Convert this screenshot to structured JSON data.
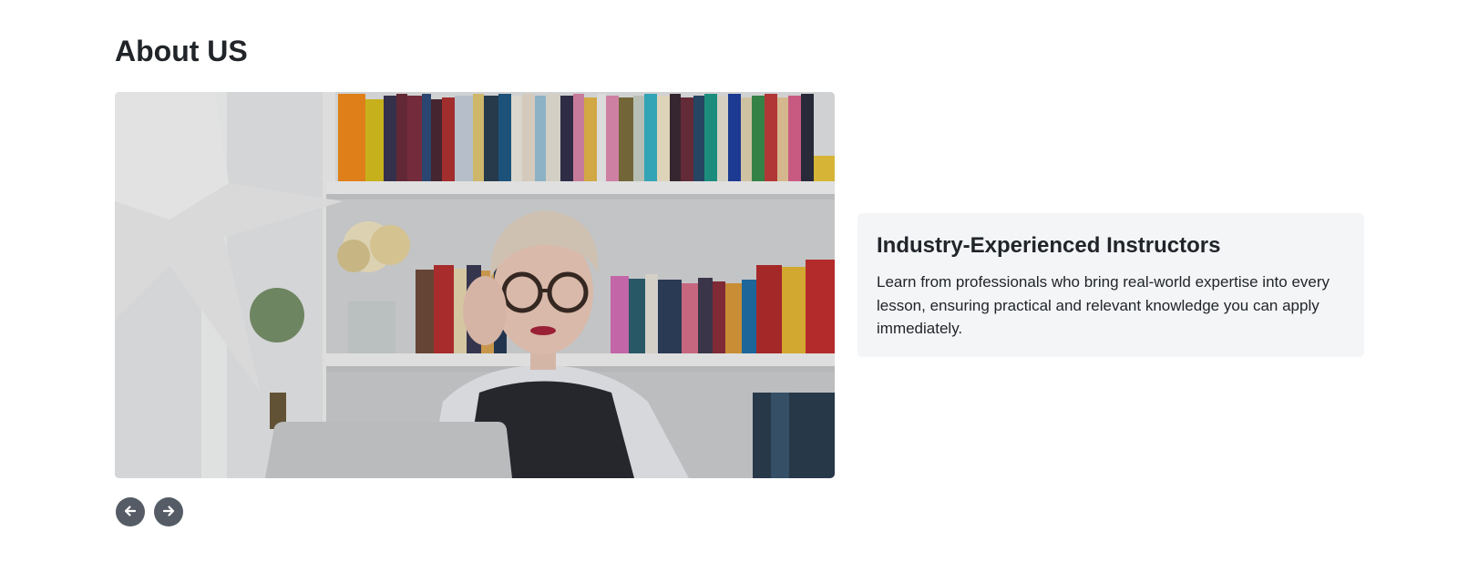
{
  "section": {
    "title": "About US"
  },
  "slide": {
    "image_alt": "Woman with glasses sitting in front of a bookshelf",
    "heading": "Industry-Experienced Instructors",
    "body": "Learn from professionals who bring real-world expertise into every lesson, ensuring practical and relevant knowledge you can apply immediately."
  },
  "controls": {
    "prev_icon": "arrow-left-icon",
    "next_icon": "arrow-right-icon"
  },
  "colors": {
    "text": "#212529",
    "card_bg": "#f4f5f7",
    "button_bg": "#555c66"
  }
}
